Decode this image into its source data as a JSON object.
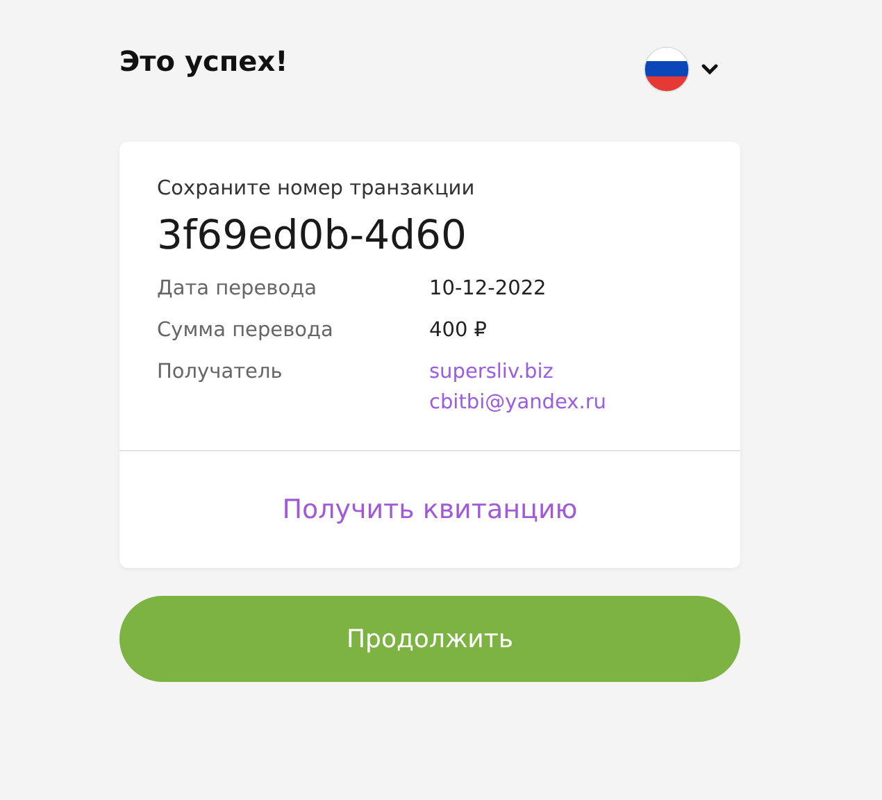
{
  "header": {
    "title": "Это успех!",
    "language": {
      "kind": "ru-flag"
    }
  },
  "card": {
    "caption": "Сохраните номер транзакции",
    "transaction_id": "3f69ed0b-4d60",
    "fields": [
      {
        "label": "Дата перевода",
        "kind": "text",
        "values": [
          "10-12-2022"
        ]
      },
      {
        "label": "Сумма перевода",
        "kind": "text",
        "values": [
          "400 ₽"
        ]
      },
      {
        "label": "Получатель",
        "kind": "link",
        "values": [
          "supersliv.biz",
          "cbitbi@yandex.ru"
        ]
      }
    ],
    "receipt_link": "Получить квитанцию"
  },
  "continue_button": "Продолжить"
}
